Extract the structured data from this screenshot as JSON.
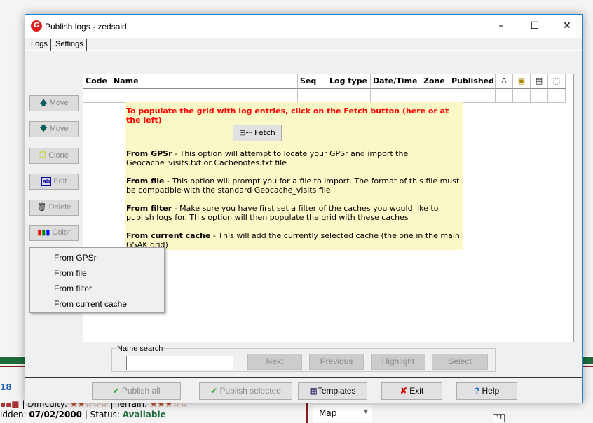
{
  "window": {
    "title": "Publish logs  - zedsaid",
    "minimize": "–",
    "maximize": "☐",
    "close": "✕"
  },
  "tabs": [
    {
      "label": "Logs",
      "active": true
    },
    {
      "label": "Settings"
    }
  ],
  "grid": {
    "columns": [
      "Code",
      "Name",
      "Seq",
      "Log type",
      "Date/Time",
      "Zone",
      "Published"
    ],
    "icon_columns": [
      "user-icon",
      "image-icon",
      "document-icon",
      "eraser-icon"
    ]
  },
  "help_panel": {
    "heading": "To populate the grid with log entries, click on the Fetch button (here or at the left)",
    "fetch_label": "Fetch",
    "items": [
      {
        "term": "From GPSr",
        "text": " - This option will attempt to locate your GPSr and import the Geocache_visits.txt or Cachenotes.txt file"
      },
      {
        "term": "From file",
        "text": " - This option will prompt you for a file to import. The format of this file must be compatible with the standard Geocache_visits file"
      },
      {
        "term": "From filter",
        "text": " - Make sure you have first set a filter of the caches you would like to publish logs for. This option will then populate the grid with these caches"
      },
      {
        "term": "From current cache",
        "text": " - This will add the currently selected cache (the one in the main GSAK grid)"
      }
    ]
  },
  "side_buttons": [
    {
      "label": "Move",
      "icon": "arrow-up-icon"
    },
    {
      "label": "Move",
      "icon": "arrow-down-icon"
    },
    {
      "label": "Clone",
      "icon": "clone-icon"
    },
    {
      "label": "Edit",
      "icon": "edit-icon"
    },
    {
      "label": "Delete",
      "icon": "trash-icon"
    },
    {
      "label": "Color",
      "icon": "crayons-icon"
    }
  ],
  "fetch_menu": [
    "From GPSr",
    "From file",
    "From filter",
    "From current cache"
  ],
  "name_search": {
    "label": "Name search",
    "value": "",
    "buttons": [
      "Next",
      "Previous",
      "Highlight",
      "Select"
    ]
  },
  "footer": {
    "publish_all": "Publish all",
    "publish_selected": "Publish selected",
    "templates": "Templates",
    "exit": "Exit",
    "help": "Help"
  },
  "background": {
    "link": "18",
    "difficulty": "| Difficulty:",
    "terrain": "| Terrain:",
    "hidden_label": "idden:",
    "hidden_date": "07/02/2000",
    "status_label": "| Status:",
    "status": "Available",
    "map": "Map",
    "day": "31"
  },
  "colors": {
    "accent": "#1883d7",
    "panel": "#fbf8c8",
    "heading": "#ff0000",
    "status": "#1e6b3a"
  }
}
